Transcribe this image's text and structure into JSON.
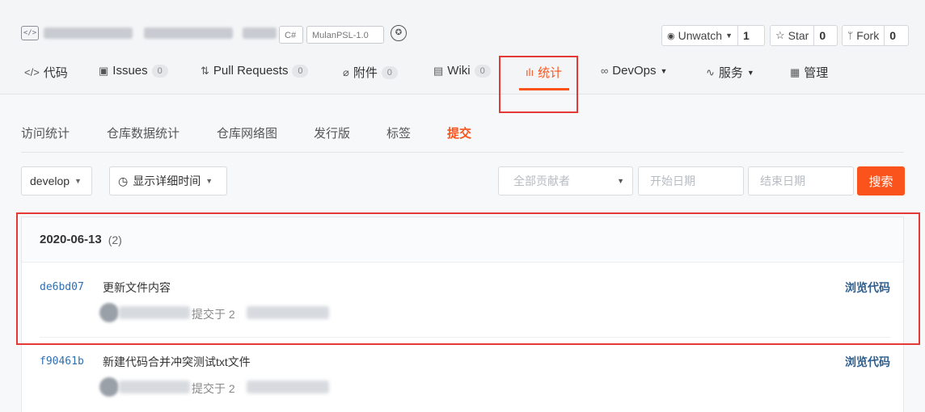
{
  "repo": {
    "icon": "code-repo-icon",
    "language_tag": "C#",
    "license_tag": "MulanPSL-1.0",
    "badge_icon": "award-badge-icon",
    "watch": {
      "label": "Unwatch",
      "count": "1",
      "icon": "eye-icon"
    },
    "star": {
      "label": "Star",
      "count": "0",
      "icon": "star-icon"
    },
    "fork": {
      "label": "Fork",
      "count": "0",
      "icon": "fork-icon"
    }
  },
  "nav": {
    "items": [
      {
        "label": "代码",
        "icon": "code-icon",
        "count": ""
      },
      {
        "label": "Issues",
        "icon": "issues-icon",
        "count": "0"
      },
      {
        "label": "Pull Requests",
        "icon": "pull-request-icon",
        "count": "0"
      },
      {
        "label": "附件",
        "icon": "attachment-icon",
        "count": "0"
      },
      {
        "label": "Wiki",
        "icon": "wiki-icon",
        "count": "0"
      },
      {
        "label": "统计",
        "icon": "stats-icon",
        "count": "",
        "active": true
      },
      {
        "label": "DevOps",
        "icon": "devops-icon",
        "count": ""
      },
      {
        "label": "服务",
        "icon": "service-icon",
        "count": ""
      },
      {
        "label": "管理",
        "icon": "manage-icon",
        "count": ""
      }
    ]
  },
  "subtabs": [
    "访问统计",
    "仓库数据统计",
    "仓库网络图",
    "发行版",
    "标签",
    "提交"
  ],
  "filters": {
    "branch": "develop",
    "time_toggle": "显示详细时间",
    "contributors_placeholder": "全部贡献者",
    "start_date_placeholder": "开始日期",
    "end_date_placeholder": "结束日期",
    "search_label": "搜索"
  },
  "commit_group": {
    "date": "2020-06-13",
    "count": "(2)",
    "commits": [
      {
        "sha": "de6bd07",
        "message": "更新文件内容",
        "meta": "提交于 2",
        "link": "浏览代码"
      },
      {
        "sha": "f90461b",
        "message": "新建代码合并冲突测试txt文件",
        "meta": "提交于 2",
        "link": "浏览代码"
      }
    ]
  },
  "colors": {
    "accent": "#fa541c",
    "highlight_box": "#e53935",
    "sha": "#2f6fb0"
  }
}
